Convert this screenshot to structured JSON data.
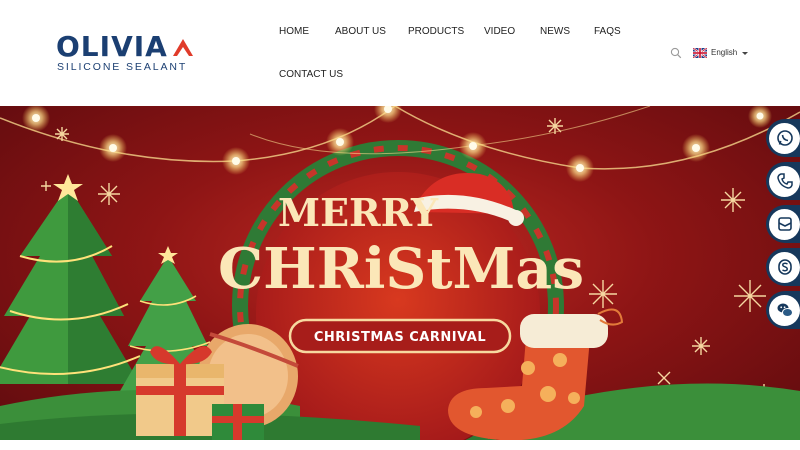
{
  "logo": {
    "name": "OLIVIA",
    "tagline": "SILICONE SEALANT"
  },
  "nav": {
    "items": [
      {
        "label": "HOME"
      },
      {
        "label": "ABOUT US"
      },
      {
        "label": "PRODUCTS"
      },
      {
        "label": "VIDEO"
      },
      {
        "label": "NEWS"
      },
      {
        "label": "FAQS"
      },
      {
        "label": "CONTACT US"
      }
    ]
  },
  "language": {
    "label": "English",
    "flag": "uk-flag-icon"
  },
  "banner": {
    "line1": "MERRY",
    "line2": "CHRiStMas",
    "button": "CHRISTMAS CARNIVAL"
  },
  "side_buttons": [
    {
      "icon": "whatsapp-icon"
    },
    {
      "icon": "phone-icon"
    },
    {
      "icon": "email-icon"
    },
    {
      "icon": "skype-icon"
    },
    {
      "icon": "wechat-icon"
    }
  ],
  "colors": {
    "brand_blue": "#1b3f72",
    "brand_red": "#e03b2a",
    "banner_red": "#8e1515",
    "side_bar": "#16385c",
    "banner_text": "#fbe7b8"
  }
}
